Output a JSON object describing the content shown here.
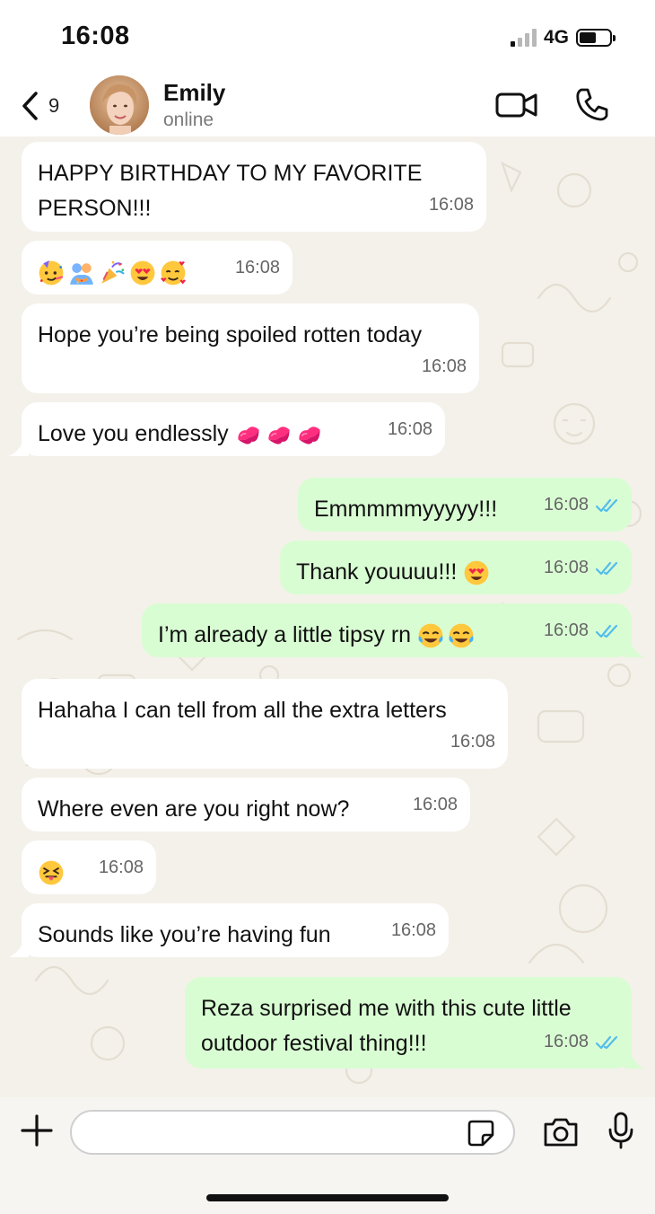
{
  "status_bar": {
    "time": "16:08",
    "network": "4G"
  },
  "header": {
    "back_count": "9",
    "contact_name": "Emily",
    "contact_status": "online"
  },
  "messages": [
    {
      "dir": "in",
      "text": "HAPPY BIRTHDAY TO MY FAVORITE PERSON!!!",
      "time": "16:08"
    },
    {
      "dir": "in",
      "text": "",
      "emojis": [
        "partying-face",
        "people-hugging",
        "party-popper",
        "heart-eyes",
        "smiling-face-with-hearts"
      ],
      "time": "16:08"
    },
    {
      "dir": "in",
      "text": "Hope you’re being spoiled rotten today",
      "time": "16:08"
    },
    {
      "dir": "in",
      "text": "Love you endlessly",
      "emojis": [
        "kiss-mark",
        "kiss-mark",
        "kiss-mark"
      ],
      "time": "16:08"
    },
    {
      "dir": "out",
      "text": "Emmmmmyyyyy!!!",
      "time": "16:08",
      "status": "read"
    },
    {
      "dir": "out",
      "text": "Thank youuuu!!!",
      "emojis": [
        "heart-eyes"
      ],
      "time": "16:08",
      "status": "read"
    },
    {
      "dir": "out",
      "text": "I’m already a little tipsy rn",
      "emojis": [
        "tears-of-joy",
        "tears-of-joy"
      ],
      "time": "16:08",
      "status": "read"
    },
    {
      "dir": "in",
      "text": "Hahaha I can tell from all the extra letters",
      "time": "16:08"
    },
    {
      "dir": "in",
      "text": "Where even are you right now?",
      "time": "16:08"
    },
    {
      "dir": "in",
      "text": "",
      "emojis": [
        "squinting-tongue"
      ],
      "time": "16:08"
    },
    {
      "dir": "in",
      "text": "Sounds like you’re having fun",
      "time": "16:08"
    },
    {
      "dir": "out",
      "text": "Reza surprised me with this cute little outdoor festival thing!!!",
      "time": "16:08",
      "status": "read"
    }
  ],
  "input": {
    "placeholder": ""
  },
  "colors": {
    "incoming": "#ffffff",
    "outgoing": "#d9fdd3",
    "read_ticks": "#53bdeb",
    "wallpaper": "#f4f1ea"
  }
}
